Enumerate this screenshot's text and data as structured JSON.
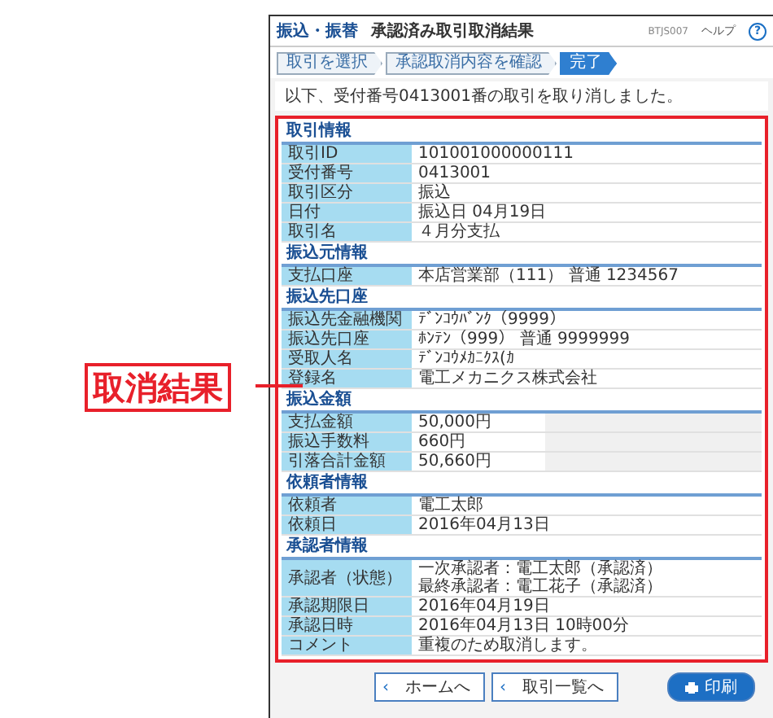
{
  "header": {
    "breadcrumb": "振込・振替",
    "title": "承認済み取引取消結果",
    "screen_id": "BTJS007",
    "help": "ヘルプ",
    "help_icon": "?"
  },
  "steps": [
    {
      "label": "取引を選択",
      "selected": false
    },
    {
      "label": "承認取消内容を確認",
      "selected": false
    },
    {
      "label": "完了",
      "selected": true
    }
  ],
  "message": "以下、受付番号0413001番の取引を取り消しました。",
  "annotation": "取消結果",
  "sections": [
    {
      "title": "取引情報",
      "kind": "full",
      "rows": [
        {
          "label": "取引ID",
          "values": [
            "101001000000111"
          ]
        },
        {
          "label": "受付番号",
          "values": [
            "0413001"
          ]
        },
        {
          "label": "取引区分",
          "values": [
            "振込"
          ]
        },
        {
          "label": "日付",
          "values": [
            "振込日 04月19日"
          ]
        },
        {
          "label": "取引名",
          "values": [
            "４月分支払"
          ]
        }
      ]
    },
    {
      "title": "振込元情報",
      "kind": "full",
      "rows": [
        {
          "label": "支払口座",
          "values": [
            "本店営業部（111） 普通 1234567"
          ]
        }
      ]
    },
    {
      "title": "振込先口座",
      "kind": "full",
      "rows": [
        {
          "label": "振込先金融機関",
          "values": [
            "ﾃﾞﾝｺｳﾊﾞﾝｸ（9999）"
          ]
        },
        {
          "label": "振込先口座",
          "values": [
            "ﾎﾝﾃﾝ（999） 普通 9999999"
          ]
        },
        {
          "label": "受取人名",
          "values": [
            "ﾃﾞﾝｺｳﾒｶﾆｸｽ(ｶ"
          ]
        },
        {
          "label": "登録名",
          "values": [
            "電工メカニクス株式会社"
          ]
        }
      ]
    },
    {
      "title": "振込金額",
      "kind": "amount",
      "rows": [
        {
          "label": "支払金額",
          "values": [
            "50,000円"
          ]
        },
        {
          "label": "振込手数料",
          "values": [
            "660円"
          ]
        },
        {
          "label": "引落合計金額",
          "values": [
            "50,660円"
          ]
        }
      ]
    },
    {
      "title": "依頼者情報",
      "kind": "full",
      "rows": [
        {
          "label": "依頼者",
          "values": [
            "電工太郎"
          ]
        },
        {
          "label": "依頼日",
          "values": [
            "2016年04月13日"
          ]
        }
      ]
    },
    {
      "title": "承認者情報",
      "kind": "full",
      "rows": [
        {
          "label": "承認者（状態）",
          "values": [
            "一次承認者：電工太郎（承認済）",
            "最終承認者：電工花子（承認済）"
          ]
        },
        {
          "label": "承認期限日",
          "values": [
            "2016年04月19日"
          ]
        },
        {
          "label": "承認日時",
          "values": [
            "2016年04月13日 10時00分"
          ]
        },
        {
          "label": "コメント",
          "values": [
            "重複のため取消します。"
          ]
        }
      ]
    }
  ],
  "buttons": [
    {
      "label": "ホームへ",
      "icon": "‹",
      "kind": "back"
    },
    {
      "label": "取引一覧へ",
      "icon": "‹",
      "kind": "back"
    },
    {
      "label": "印刷",
      "kind": "print"
    }
  ]
}
